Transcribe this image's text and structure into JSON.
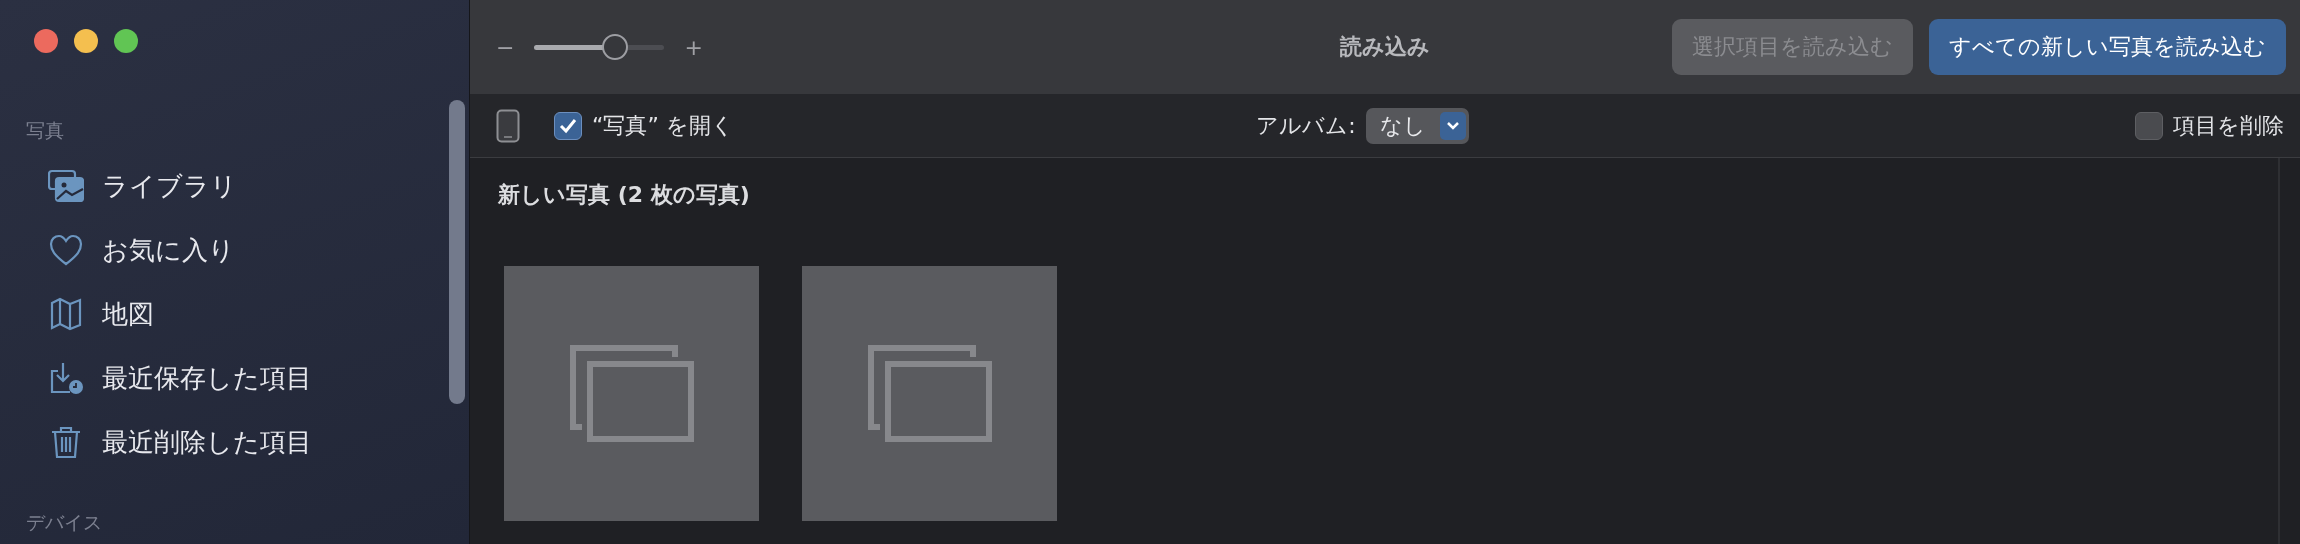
{
  "window_controls": [
    {
      "color": "#ec6a5e"
    },
    {
      "color": "#f4bf4f"
    },
    {
      "color": "#61c554"
    }
  ],
  "sidebar": {
    "sections": [
      {
        "title": "写真",
        "items": [
          {
            "label": "ライブラリ",
            "kind": "library"
          },
          {
            "label": "お気に入り",
            "kind": "favorites"
          },
          {
            "label": "地図",
            "kind": "map"
          },
          {
            "label": "最近保存した項目",
            "kind": "saved"
          },
          {
            "label": "最近削除した項目",
            "kind": "deleted"
          }
        ]
      },
      {
        "title": "デバイス"
      }
    ]
  },
  "toolbar": {
    "zoom_slider": {
      "minus": "−",
      "plus": "+",
      "level": 0.62
    },
    "title": "読み込み",
    "buttons": [
      {
        "label": "選択項目を読み込む",
        "kind": "secondary",
        "disabled": true
      },
      {
        "label": "すべての新しい写真を読み込む",
        "kind": "primary",
        "disabled": false
      }
    ]
  },
  "options_bar": {
    "open_photos": {
      "label": "“写真” を開く",
      "checked": true
    },
    "album": {
      "label": "アルバム:",
      "value": "なし"
    },
    "delete_items": {
      "label": "項目を削除",
      "checked": false
    }
  },
  "content": {
    "heading": "新しい写真 (2 枚の写真)",
    "thumbnails": [
      {
        "kind": "placeholder"
      },
      {
        "kind": "placeholder"
      }
    ]
  }
}
